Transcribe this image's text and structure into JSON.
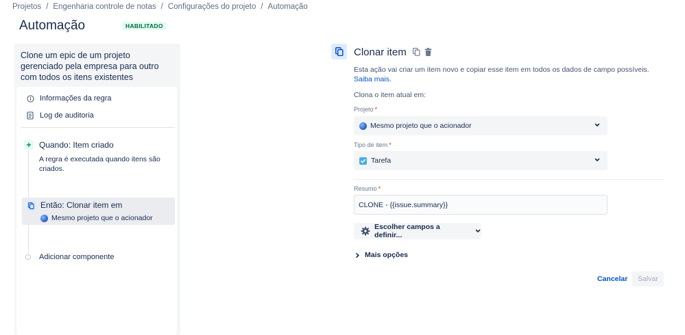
{
  "breadcrumbs": [
    "Projetos",
    "Engenharia controle de notas",
    "Configurações do projeto",
    "Automação"
  ],
  "breadcrumb_separator": "/",
  "page": {
    "title": "Automação",
    "status": "HABILITADO"
  },
  "sidebar": {
    "rule_name": "Clone um epic de um projeto gerenciado pela empresa para outro com todos os itens existentes",
    "menu": [
      {
        "label": "Informações da regra",
        "icon": "info-icon"
      },
      {
        "label": "Log de auditoria",
        "icon": "audit-log-icon"
      }
    ],
    "trigger": {
      "title": "Quando: Item criado",
      "description": "A regra é executada quando itens são criados.",
      "icon": "plus-icon"
    },
    "action": {
      "title": "Então: Clonar item em",
      "subtitle": "Mesmo projeto que o acionador",
      "icon": "clone-icon"
    },
    "add_component": "Adicionar componente"
  },
  "action_panel": {
    "title": "Clonar item",
    "description": "Esta ação vai criar um item novo e copiar esse item em todos os dados de campo possíveis.",
    "learn_more": "Saiba mais.",
    "clone_into_label": "Clona o item atual em:",
    "project": {
      "label": "Projeto",
      "required_mark": "*",
      "value": "Mesmo projeto que o acionador"
    },
    "issue_type": {
      "label": "Tipo de item",
      "required_mark": "*",
      "value": "Tarefa"
    },
    "summary": {
      "label": "Resumo",
      "required_mark": "*",
      "value": "CLONE - {{issue.summary}}"
    },
    "choose_fields": "Escolher campos a definir...",
    "more_options": "Mais opções",
    "cancel": "Cancelar",
    "save": "Salvar"
  },
  "colors": {
    "accent": "#0052cc",
    "success_bg": "#e3fcef",
    "success_text": "#006644",
    "required": "#de350b"
  }
}
